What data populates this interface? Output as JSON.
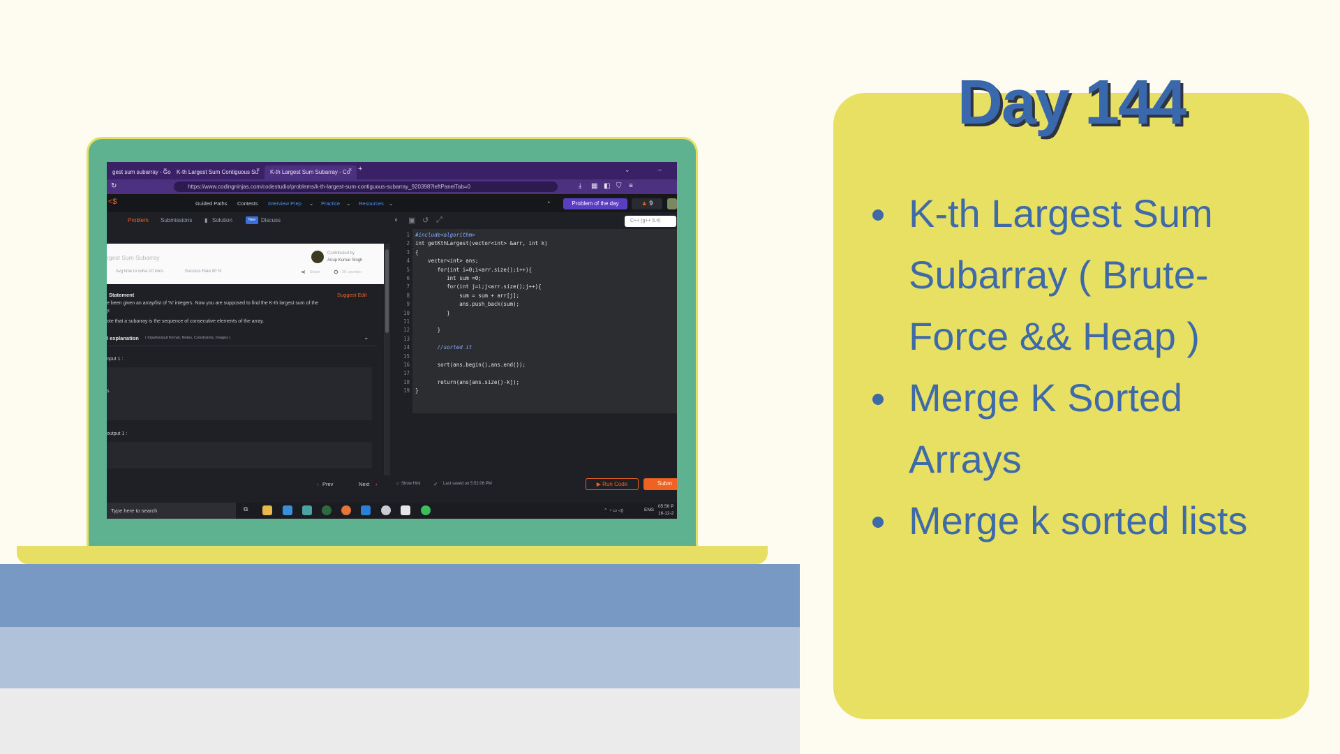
{
  "panel": {
    "title": "Day 144",
    "topics": [
      "K-th Largest Sum Subarray ( Brute-Force && Heap )",
      "Merge K Sorted Arrays",
      "Merge k sorted lists"
    ]
  },
  "browser": {
    "tabs": [
      {
        "label": "gest sum subarray - Goo"
      },
      {
        "label": "K-th Largest Sum Contiguous Su"
      },
      {
        "label": "K-th Largest Sum Subarray - Co"
      }
    ],
    "url": "https://www.codingninjas.com/codestudio/problems/k-th-largest-sum-contiguous-subarray_920398?leftPanelTab=0"
  },
  "site": {
    "nav": [
      "Guided Paths",
      "Contests",
      "Interview Prep",
      "Practice",
      "Resources"
    ],
    "problem_of_day": "Problem of the day",
    "streak": "9"
  },
  "left_panel": {
    "tabs": [
      "Problem",
      "Submissions",
      "Solution",
      "Discuss"
    ],
    "new_badge": "New",
    "problem_title": "rgest Sum Subarray",
    "avg_time": "Avg time to solve 10 mins",
    "success_rate": "Success Rate 90 %",
    "contributed_by": "Contributed by",
    "author": "Anup Kumar Singh",
    "share": "Share",
    "upvotes": "26 upvotes",
    "statement_heading": "Statement",
    "suggest_edit": "Suggest Edit",
    "statement_line1": "e been given an array/list of 'N' integers. Now you are supposed to find the K-th largest sum of the",
    "statement_line2": "y.",
    "statement_line3": "ote that a subarray is the sequence of consecutive elements of the array.",
    "explanation_heading": "l explanation",
    "explanation_hint": "( Input/output format, Notes, Constraints, Images )",
    "input_label": "nput 1 :",
    "input_fragment": "s",
    "output_label": "output 1 :",
    "prev": "Prev",
    "next": "Next"
  },
  "editor": {
    "language": "C++ (g++ 5.4)",
    "line_numbers": [
      "1",
      "2",
      "3",
      "4",
      "5",
      "6",
      "7",
      "8",
      "9",
      "10",
      "11",
      "12",
      "13",
      "14",
      "15",
      "16",
      "17",
      "18",
      "19"
    ],
    "code_lines": [
      "#include<algorithm>",
      "int getKthLargest(vector<int> &arr, int k)",
      "{",
      "",
      "    vector<int> ans;",
      "       for(int i=0;i<arr.size();i++){",
      "          int sum =0;",
      "          for(int j=i;j<arr.size();j++){",
      "              sum = sum + arr[j];",
      "              ans.push_back(sum);",
      "          }",
      "",
      "       }",
      "",
      "       //sorted it",
      "",
      "       sort(ans.begin(),ans.end());",
      "",
      "       return(ans[ans.size()-k]);",
      "}"
    ],
    "show_hint": "Show Hint",
    "last_saved": "Last saved on 5:52:06 PM",
    "run_code": "Run Code",
    "submit": "Subm"
  },
  "taskbar": {
    "search": "Type here to search",
    "lang": "ENG",
    "time": "05:56 P",
    "date": "16-12-2"
  }
}
